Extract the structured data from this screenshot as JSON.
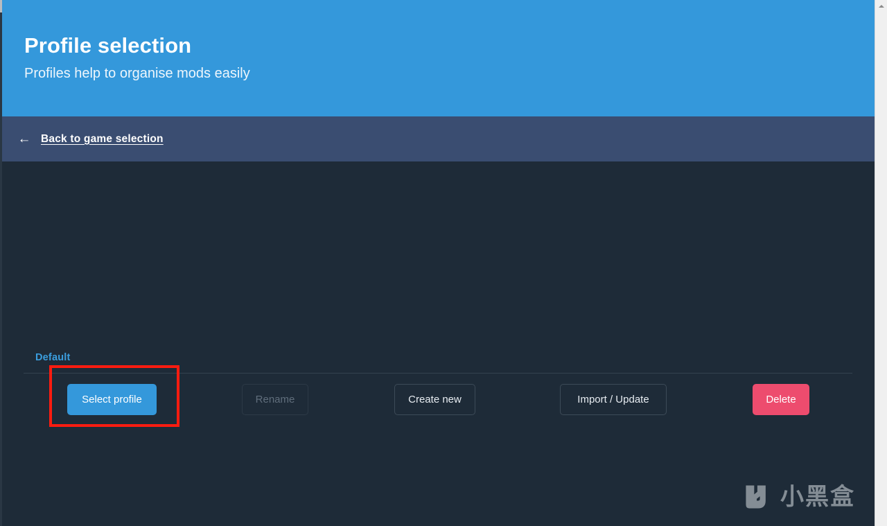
{
  "window": {
    "background_color": "#1e2b38"
  },
  "header": {
    "title": "Profile selection",
    "subtitle": "Profiles help to organise mods easily",
    "background_color": "#3498db"
  },
  "navbar": {
    "back_arrow_icon": "←",
    "back_label": "Back to game selection",
    "background_color": "#3a4d71"
  },
  "main": {
    "profile_group_label": "Default",
    "group_label_color": "#3b9ede",
    "buttons": [
      {
        "label": "Select profile",
        "style": "primary",
        "enabled": true,
        "color": "#3498db"
      },
      {
        "label": "Rename",
        "style": "outline",
        "enabled": false,
        "color": "#606e7c"
      },
      {
        "label": "Create new",
        "style": "outline",
        "enabled": true,
        "color": "#e8edf2"
      },
      {
        "label": "Import / Update",
        "style": "outline",
        "enabled": true,
        "color": "#e8edf2"
      },
      {
        "label": "Delete",
        "style": "danger",
        "enabled": true,
        "color": "#ed4c6e"
      }
    ]
  },
  "annotation": {
    "highlight_color": "#fc1c10",
    "target": "Select profile"
  },
  "watermark": {
    "text": "小黑盒",
    "logo_icon": "heybox-logo-icon",
    "color": "#c3c9cf"
  },
  "scrollbar": {
    "up_arrow_icon": "caret-up-icon",
    "track_color": "#f0f0f0",
    "thumb_color": "#cdcdcd"
  }
}
